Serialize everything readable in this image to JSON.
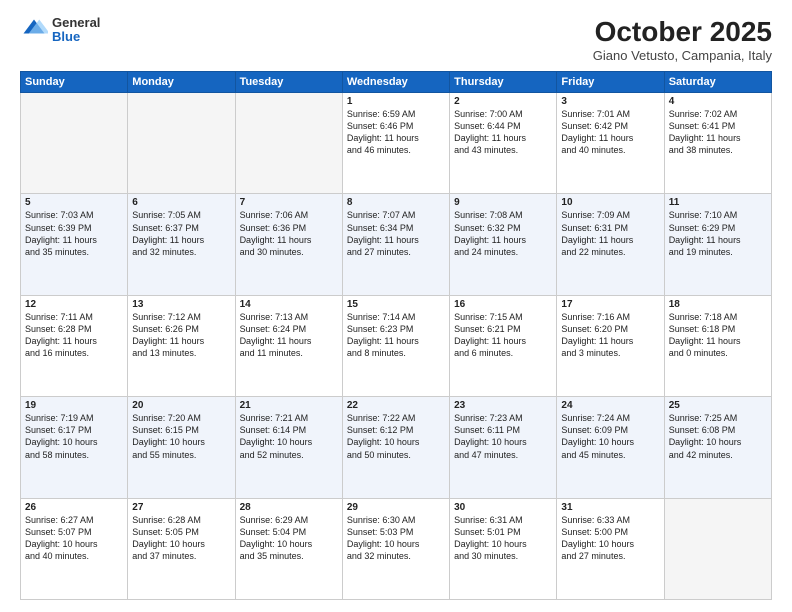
{
  "header": {
    "logo_general": "General",
    "logo_blue": "Blue",
    "month_title": "October 2025",
    "subtitle": "Giano Vetusto, Campania, Italy"
  },
  "weekdays": [
    "Sunday",
    "Monday",
    "Tuesday",
    "Wednesday",
    "Thursday",
    "Friday",
    "Saturday"
  ],
  "weeks": [
    [
      {
        "day": "",
        "info": ""
      },
      {
        "day": "",
        "info": ""
      },
      {
        "day": "",
        "info": ""
      },
      {
        "day": "1",
        "info": "Sunrise: 6:59 AM\nSunset: 6:46 PM\nDaylight: 11 hours\nand 46 minutes."
      },
      {
        "day": "2",
        "info": "Sunrise: 7:00 AM\nSunset: 6:44 PM\nDaylight: 11 hours\nand 43 minutes."
      },
      {
        "day": "3",
        "info": "Sunrise: 7:01 AM\nSunset: 6:42 PM\nDaylight: 11 hours\nand 40 minutes."
      },
      {
        "day": "4",
        "info": "Sunrise: 7:02 AM\nSunset: 6:41 PM\nDaylight: 11 hours\nand 38 minutes."
      }
    ],
    [
      {
        "day": "5",
        "info": "Sunrise: 7:03 AM\nSunset: 6:39 PM\nDaylight: 11 hours\nand 35 minutes."
      },
      {
        "day": "6",
        "info": "Sunrise: 7:05 AM\nSunset: 6:37 PM\nDaylight: 11 hours\nand 32 minutes."
      },
      {
        "day": "7",
        "info": "Sunrise: 7:06 AM\nSunset: 6:36 PM\nDaylight: 11 hours\nand 30 minutes."
      },
      {
        "day": "8",
        "info": "Sunrise: 7:07 AM\nSunset: 6:34 PM\nDaylight: 11 hours\nand 27 minutes."
      },
      {
        "day": "9",
        "info": "Sunrise: 7:08 AM\nSunset: 6:32 PM\nDaylight: 11 hours\nand 24 minutes."
      },
      {
        "day": "10",
        "info": "Sunrise: 7:09 AM\nSunset: 6:31 PM\nDaylight: 11 hours\nand 22 minutes."
      },
      {
        "day": "11",
        "info": "Sunrise: 7:10 AM\nSunset: 6:29 PM\nDaylight: 11 hours\nand 19 minutes."
      }
    ],
    [
      {
        "day": "12",
        "info": "Sunrise: 7:11 AM\nSunset: 6:28 PM\nDaylight: 11 hours\nand 16 minutes."
      },
      {
        "day": "13",
        "info": "Sunrise: 7:12 AM\nSunset: 6:26 PM\nDaylight: 11 hours\nand 13 minutes."
      },
      {
        "day": "14",
        "info": "Sunrise: 7:13 AM\nSunset: 6:24 PM\nDaylight: 11 hours\nand 11 minutes."
      },
      {
        "day": "15",
        "info": "Sunrise: 7:14 AM\nSunset: 6:23 PM\nDaylight: 11 hours\nand 8 minutes."
      },
      {
        "day": "16",
        "info": "Sunrise: 7:15 AM\nSunset: 6:21 PM\nDaylight: 11 hours\nand 6 minutes."
      },
      {
        "day": "17",
        "info": "Sunrise: 7:16 AM\nSunset: 6:20 PM\nDaylight: 11 hours\nand 3 minutes."
      },
      {
        "day": "18",
        "info": "Sunrise: 7:18 AM\nSunset: 6:18 PM\nDaylight: 11 hours\nand 0 minutes."
      }
    ],
    [
      {
        "day": "19",
        "info": "Sunrise: 7:19 AM\nSunset: 6:17 PM\nDaylight: 10 hours\nand 58 minutes."
      },
      {
        "day": "20",
        "info": "Sunrise: 7:20 AM\nSunset: 6:15 PM\nDaylight: 10 hours\nand 55 minutes."
      },
      {
        "day": "21",
        "info": "Sunrise: 7:21 AM\nSunset: 6:14 PM\nDaylight: 10 hours\nand 52 minutes."
      },
      {
        "day": "22",
        "info": "Sunrise: 7:22 AM\nSunset: 6:12 PM\nDaylight: 10 hours\nand 50 minutes."
      },
      {
        "day": "23",
        "info": "Sunrise: 7:23 AM\nSunset: 6:11 PM\nDaylight: 10 hours\nand 47 minutes."
      },
      {
        "day": "24",
        "info": "Sunrise: 7:24 AM\nSunset: 6:09 PM\nDaylight: 10 hours\nand 45 minutes."
      },
      {
        "day": "25",
        "info": "Sunrise: 7:25 AM\nSunset: 6:08 PM\nDaylight: 10 hours\nand 42 minutes."
      }
    ],
    [
      {
        "day": "26",
        "info": "Sunrise: 6:27 AM\nSunset: 5:07 PM\nDaylight: 10 hours\nand 40 minutes."
      },
      {
        "day": "27",
        "info": "Sunrise: 6:28 AM\nSunset: 5:05 PM\nDaylight: 10 hours\nand 37 minutes."
      },
      {
        "day": "28",
        "info": "Sunrise: 6:29 AM\nSunset: 5:04 PM\nDaylight: 10 hours\nand 35 minutes."
      },
      {
        "day": "29",
        "info": "Sunrise: 6:30 AM\nSunset: 5:03 PM\nDaylight: 10 hours\nand 32 minutes."
      },
      {
        "day": "30",
        "info": "Sunrise: 6:31 AM\nSunset: 5:01 PM\nDaylight: 10 hours\nand 30 minutes."
      },
      {
        "day": "31",
        "info": "Sunrise: 6:33 AM\nSunset: 5:00 PM\nDaylight: 10 hours\nand 27 minutes."
      },
      {
        "day": "",
        "info": ""
      }
    ]
  ]
}
